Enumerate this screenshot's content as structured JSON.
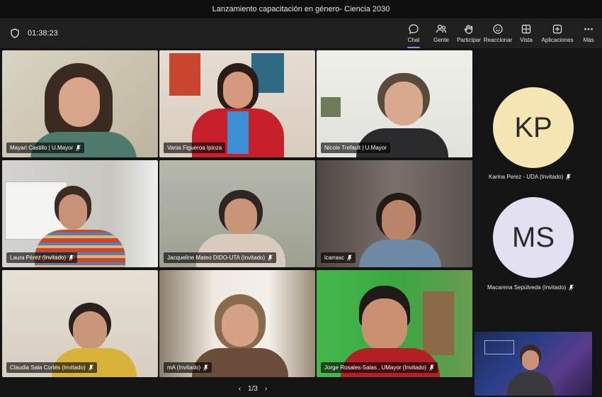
{
  "window": {
    "title": "Lanzamiento capacitación en género- Ciencia 2030"
  },
  "toolbar": {
    "timer": "01:38:23",
    "buttons": [
      {
        "label": "Chat",
        "icon": "chat-icon"
      },
      {
        "label": "Gente",
        "icon": "people-icon"
      },
      {
        "label": "Participar",
        "icon": "raise-hand-icon"
      },
      {
        "label": "Reaccionar",
        "icon": "smile-icon"
      },
      {
        "label": "Vista",
        "icon": "grid-view-icon"
      },
      {
        "label": "Aplicaciones",
        "icon": "add-apps-icon"
      },
      {
        "label": "Más",
        "icon": "more-icon"
      }
    ]
  },
  "tiles": [
    {
      "name": "Mayari Castillo | U.Mayor",
      "muted": true
    },
    {
      "name": "Vania Figueroa Ipinza",
      "muted": false
    },
    {
      "name": "Nicole Trefault | U.Mayor",
      "muted": false,
      "speaking": true
    },
    {
      "name": "Laura Pérez (Invitado)",
      "muted": true
    },
    {
      "name": "Jacqueline Mateo DIDO-UTA (Invitado)",
      "muted": true
    },
    {
      "name": "lcarrasc",
      "muted": true
    },
    {
      "name": "Claudia Sala Cortés (Invitado)",
      "muted": true
    },
    {
      "name": "mA (Invitado)",
      "muted": true
    },
    {
      "name": "Jorge Rosales-Salas , UMayor (Invitado)",
      "muted": true
    }
  ],
  "side_participants": [
    {
      "initials": "KP",
      "name": "Karina Perez - UDA (Invitado)",
      "color": "#f6e6b4"
    },
    {
      "initials": "MS",
      "name": "Macarena Sepúlveda (Invitado)",
      "color": "#e3e0f2"
    }
  ],
  "pager": {
    "text": "1/3"
  }
}
